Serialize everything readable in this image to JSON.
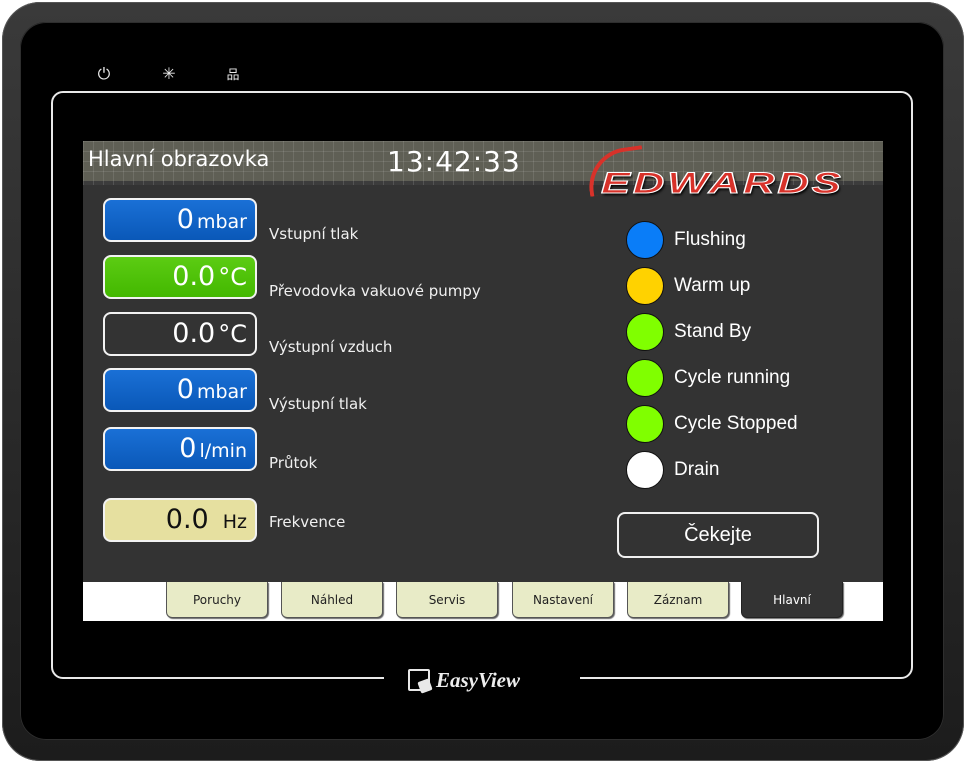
{
  "device": {
    "indicators": [
      {
        "icon": "power-icon",
        "glyph": "⏻"
      },
      {
        "icon": "sun-icon",
        "glyph": "✳"
      },
      {
        "icon": "network-icon",
        "glyph": "品"
      }
    ],
    "brand": "EasyView"
  },
  "header": {
    "title": "Hlavní obrazovka",
    "time": "13:42:33",
    "logo": "EDWARDS"
  },
  "readouts": [
    {
      "value": "0",
      "unit": "mbar",
      "label": "Vstupní tlak",
      "style": "blue"
    },
    {
      "value": "0.0",
      "unit": "°C",
      "label": "Převodovka vakuové pumpy",
      "style": "green"
    },
    {
      "value": "0.0",
      "unit": "°C",
      "label": "Výstupní vzduch",
      "style": "dark"
    },
    {
      "value": "0",
      "unit": "mbar",
      "label": "Výstupní tlak",
      "style": "blue"
    },
    {
      "value": "0",
      "unit": "l/min",
      "label": "Průtok",
      "style": "blue"
    },
    {
      "value": "0.0",
      "unit": "Hz",
      "label": "Frekvence",
      "style": "khaki"
    }
  ],
  "status": [
    {
      "label": "Flushing",
      "color": "#0a7df8"
    },
    {
      "label": "Warm up",
      "color": "#ffd200"
    },
    {
      "label": "Stand By",
      "color": "#80ff00"
    },
    {
      "label": "Cycle running",
      "color": "#80ff00"
    },
    {
      "label": "Cycle Stopped",
      "color": "#80ff00"
    },
    {
      "label": "Drain",
      "color": "#ffffff"
    }
  ],
  "wait_button": "Čekejte",
  "tabs": [
    {
      "label": "Poruchy",
      "active": false
    },
    {
      "label": "Náhled",
      "active": false
    },
    {
      "label": "Servis",
      "active": false
    },
    {
      "label": "Nastavení",
      "active": false
    },
    {
      "label": "Záznam",
      "active": false
    },
    {
      "label": "Hlavní",
      "active": true
    }
  ]
}
